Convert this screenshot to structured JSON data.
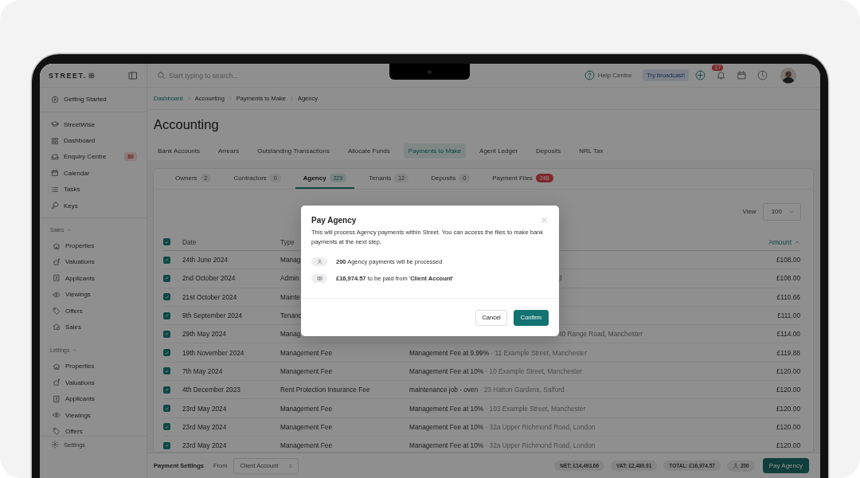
{
  "brand": {
    "name": "STREET."
  },
  "sidebar": {
    "pinned": [
      {
        "label": "Getting Started"
      }
    ],
    "items": [
      {
        "label": "StreetWise"
      },
      {
        "label": "Dashboard"
      },
      {
        "label": "Enquiry Centre",
        "badge": "80"
      },
      {
        "label": "Calendar"
      },
      {
        "label": "Tasks"
      },
      {
        "label": "Keys"
      }
    ],
    "sections": [
      {
        "title": "Sales",
        "expanded": true,
        "items": [
          {
            "label": "Properties"
          },
          {
            "label": "Valuations"
          },
          {
            "label": "Applicants"
          },
          {
            "label": "Viewings"
          },
          {
            "label": "Offers"
          },
          {
            "label": "Sales"
          }
        ]
      },
      {
        "title": "Lettings",
        "expanded": true,
        "items": [
          {
            "label": "Properties"
          },
          {
            "label": "Valuations"
          },
          {
            "label": "Applicants"
          },
          {
            "label": "Viewings"
          },
          {
            "label": "Offers"
          }
        ]
      }
    ],
    "footer": {
      "label": "Settings"
    }
  },
  "topbar": {
    "search": {
      "placeholder": "Start typing to search..."
    },
    "help": "Help Centre",
    "broadcast": "Try broadcast!",
    "notifications": "17"
  },
  "breadcrumb": [
    {
      "label": "Dashboard",
      "link": true
    },
    {
      "label": "Accounting",
      "link": false
    },
    {
      "label": "Payments to Make",
      "link": false
    },
    {
      "label": "Agency",
      "link": false
    }
  ],
  "title": "Accounting",
  "tabs": [
    {
      "label": "Bank Accounts",
      "selected": false
    },
    {
      "label": "Arrears",
      "selected": false
    },
    {
      "label": "Outstanding Transactions",
      "selected": false
    },
    {
      "label": "Allocate Funds",
      "selected": false
    },
    {
      "label": "Payments to Make",
      "selected": true
    },
    {
      "label": "Agent Ledger",
      "selected": false
    },
    {
      "label": "Deposits",
      "selected": false
    },
    {
      "label": "NRL Tax",
      "selected": false
    }
  ],
  "subtabs": [
    {
      "label": "Owners",
      "count": "2",
      "selected": false,
      "alert": false
    },
    {
      "label": "Contractors",
      "count": "0",
      "selected": false,
      "alert": false
    },
    {
      "label": "Agency",
      "count": "223",
      "selected": true,
      "alert": false
    },
    {
      "label": "Tenants",
      "count": "12",
      "selected": false,
      "alert": false
    },
    {
      "label": "Deposits",
      "count": "0",
      "selected": false,
      "alert": false
    },
    {
      "label": "Payment Files",
      "count": "248",
      "selected": false,
      "alert": true
    }
  ],
  "view": {
    "label": "View",
    "value": "100"
  },
  "table": {
    "all_checked": true,
    "columns": [
      {
        "label": "Date",
        "sorted": false
      },
      {
        "label": "Type",
        "sorted": false
      },
      {
        "label": "Amount",
        "sorted": true
      }
    ],
    "rows": [
      {
        "checked": true,
        "date": "24th June 2024",
        "type": "Manag",
        "amount": "£108.00"
      },
      {
        "checked": true,
        "date": "2nd October 2024",
        "type": "Admin",
        "tail": "d",
        "amount": "£108.00"
      },
      {
        "checked": true,
        "date": "21st October 2024",
        "type": "Mainte",
        "amount": "£110.66"
      },
      {
        "checked": true,
        "date": "9th September 2024",
        "type": "Tenanc",
        "amount": "£111.00"
      },
      {
        "checked": true,
        "date": "29th May 2024",
        "type": "Manag",
        "tail": "40 Range Road, Manchester",
        "amount": "£114.00"
      },
      {
        "checked": true,
        "date": "19th November 2024",
        "type": "Management Fee",
        "description": "Management Fee at 9.99%",
        "address": "· 11 Example Street, Manchester",
        "amount": "£119.88"
      },
      {
        "checked": true,
        "date": "7th May 2024",
        "type": "Management Fee",
        "description": "Management Fee at 10%",
        "address": "· 10 Example Street, Manchester",
        "amount": "£120.00"
      },
      {
        "checked": true,
        "date": "4th December 2023",
        "type": "Rent Protection Insurance Fee",
        "description": "maintenance job - oven",
        "address": "· 23 Hatton Gardens, Salford",
        "amount": "£120.00"
      },
      {
        "checked": true,
        "date": "23rd May 2024",
        "type": "Management Fee",
        "description": "Management Fee at 10%",
        "address": "· 103 Example Street, Manchester",
        "amount": "£120.00"
      },
      {
        "checked": true,
        "date": "23rd May 2024",
        "type": "Management Fee",
        "description": "Management Fee at 10%",
        "address": "· 32a Upper Richmond Road, London",
        "amount": "£120.00"
      },
      {
        "checked": true,
        "date": "23rd May 2024",
        "type": "Management Fee",
        "description": "Management Fee at 10%",
        "address": "· 32a Upper Richmond Road, London",
        "amount": "£120.00"
      }
    ]
  },
  "modal": {
    "title": "Pay Agency",
    "text": "This will process Agency payments within Street. You can access the files to make bank payments at the next step.",
    "lines": [
      {
        "kind": "person",
        "text": "**200** Agency payments will be processed"
      },
      {
        "kind": "cash",
        "text": "**£16,974.57** to be paid from '**Client Account**'"
      }
    ],
    "cancel": "Cancel",
    "confirm": "Confirm"
  },
  "footer": {
    "title": "Payment Settings",
    "from_label": "From",
    "account": "Client Account",
    "totals": [
      "NET: £14,493.66",
      "VAT: £2,480.91",
      "TOTAL: £16,974.57"
    ],
    "count": "200",
    "button": "Pay Agency"
  }
}
